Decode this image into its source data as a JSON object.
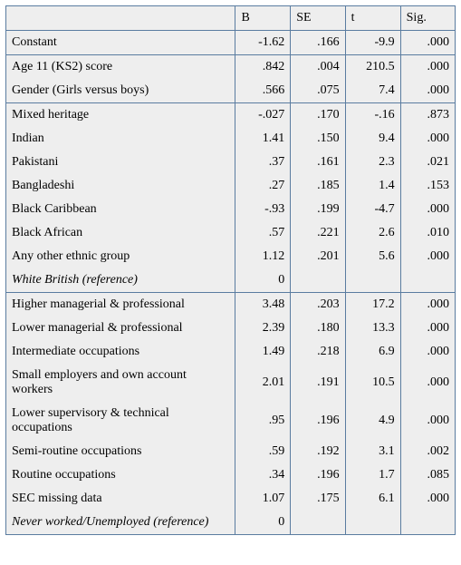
{
  "columns": {
    "b": "B",
    "se": "SE",
    "t": "t",
    "sig": "Sig."
  },
  "rows": [
    {
      "label": "Constant",
      "b": "-1.62",
      "se": ".166",
      "t": "-9.9",
      "sig": ".000"
    },
    {
      "label": "Age 11 (KS2) score",
      "b": ".842",
      "se": ".004",
      "t": "210.5",
      "sig": ".000"
    },
    {
      "label": "Gender (Girls versus boys)",
      "b": ".566",
      "se": ".075",
      "t": "7.4",
      "sig": ".000"
    },
    {
      "label": "Mixed heritage",
      "b": "-.027",
      "se": ".170",
      "t": "-.16",
      "sig": ".873"
    },
    {
      "label": "Indian",
      "b": "1.41",
      "se": ".150",
      "t": "9.4",
      "sig": ".000"
    },
    {
      "label": "Pakistani",
      "b": ".37",
      "se": ".161",
      "t": "2.3",
      "sig": ".021"
    },
    {
      "label": "Bangladeshi",
      "b": ".27",
      "se": ".185",
      "t": "1.4",
      "sig": ".153"
    },
    {
      "label": "Black Caribbean",
      "b": "-.93",
      "se": ".199",
      "t": "-4.7",
      "sig": ".000"
    },
    {
      "label": "Black African",
      "b": ".57",
      "se": ".221",
      "t": "2.6",
      "sig": ".010"
    },
    {
      "label": "Any other ethnic group",
      "b": "1.12",
      "se": ".201",
      "t": "5.6",
      "sig": ".000"
    },
    {
      "label": "White British (reference)",
      "b": "0",
      "se": "",
      "t": "",
      "sig": ""
    },
    {
      "label": "Higher managerial & professional",
      "b": "3.48",
      "se": ".203",
      "t": "17.2",
      "sig": ".000"
    },
    {
      "label": "Lower managerial & professional",
      "b": "2.39",
      "se": ".180",
      "t": "13.3",
      "sig": ".000"
    },
    {
      "label": "Intermediate occupations",
      "b": "1.49",
      "se": ".218",
      "t": "6.9",
      "sig": ".000"
    },
    {
      "label": "Small employers and own account workers",
      "b": "2.01",
      "se": ".191",
      "t": "10.5",
      "sig": ".000"
    },
    {
      "label": "Lower supervisory & technical occupations",
      "b": ".95",
      "se": ".196",
      "t": "4.9",
      "sig": ".000"
    },
    {
      "label": "Semi-routine occupations",
      "b": ".59",
      "se": ".192",
      "t": "3.1",
      "sig": ".002"
    },
    {
      "label": "Routine occupations",
      "b": ".34",
      "se": ".196",
      "t": "1.7",
      "sig": ".085"
    },
    {
      "label": "SEC missing data",
      "b": "1.07",
      "se": ".175",
      "t": "6.1",
      "sig": ".000"
    },
    {
      "label": "Never worked/Unemployed (reference)",
      "b": "0",
      "se": "",
      "t": "",
      "sig": ""
    }
  ],
  "section_breaks_after": [
    0,
    2,
    10
  ],
  "italic_rows": [
    10,
    19
  ]
}
